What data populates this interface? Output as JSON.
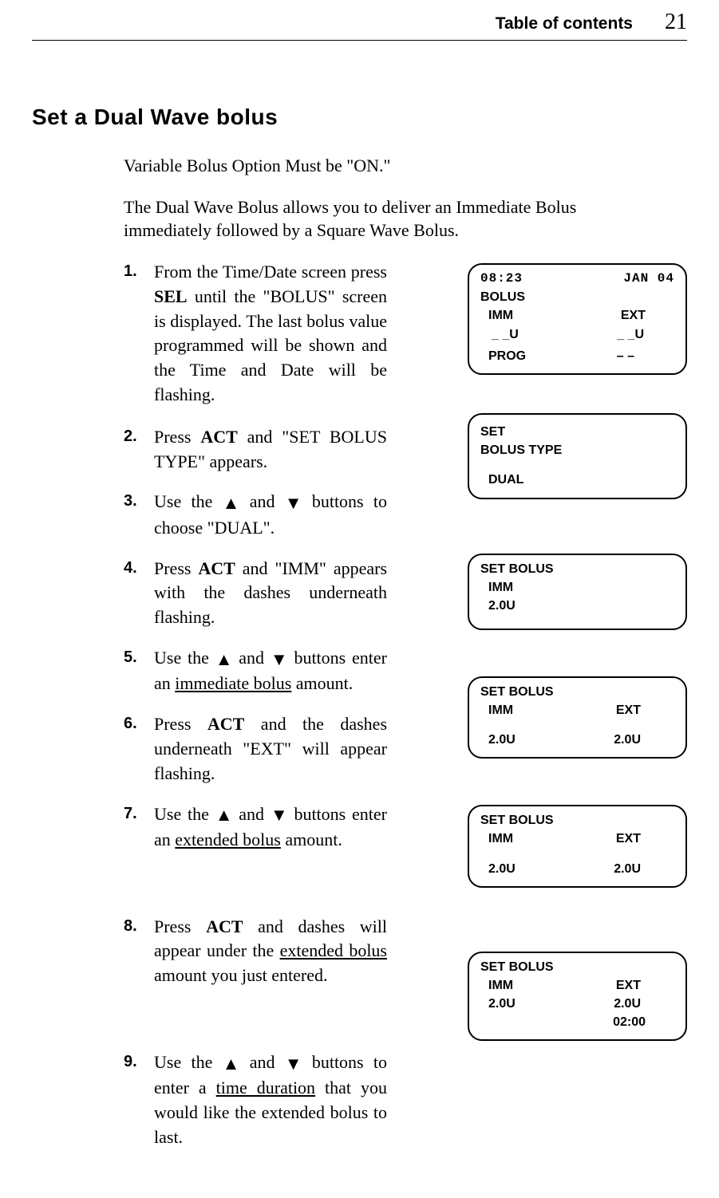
{
  "header": {
    "toc": "Table of contents",
    "page_number": "21"
  },
  "section_title": "Set a Dual Wave bolus",
  "intro1": "Variable Bolus Option Must be \"ON.\"",
  "intro2": "The Dual Wave Bolus allows you to deliver an Immediate Bolus immediately followed by a Square Wave Bolus.",
  "steps": [
    {
      "n": "1.",
      "before": "From the Time/Date screen press ",
      "bold": "SEL",
      "after": " until the \"BOLUS\" screen is displayed. The last bolus value programmed will be shown and the Time and Date will be flashing."
    },
    {
      "n": "2.",
      "before": "Press ",
      "bold": "ACT",
      "after": " and \"SET BOLUS TYPE\" appears."
    },
    {
      "n": "3.",
      "text_a": "Use the ",
      "text_b": " and ",
      "text_c": " buttons to choose \"DUAL\"."
    },
    {
      "n": "4.",
      "before": "Press ",
      "bold": "ACT",
      "after": " and \"IMM\" appears with the dashes underneath flashing."
    },
    {
      "n": "5.",
      "text_a": "Use the ",
      "text_b": " and ",
      "text_c": " buttons enter an ",
      "ul": "immediate bolus",
      "after2": " amount."
    },
    {
      "n": "6.",
      "before": "Press ",
      "bold": "ACT",
      "after": " and the dashes underneath \"EXT\" will appear flashing."
    },
    {
      "n": "7.",
      "text_a": "Use the ",
      "text_b": " and ",
      "text_c": " buttons enter an ",
      "ul": "extended bolus",
      "after2": " amount."
    },
    {
      "n": "8.",
      "before": "Press ",
      "bold": "ACT",
      "after": " and dashes will appear under the ",
      "ul": "extended bolus",
      "after2": " amount you just entered."
    },
    {
      "n": "9.",
      "text_a": "Use the ",
      "text_b": " and ",
      "text_c": " buttons to enter a ",
      "ul": "time duration",
      "after2": " that you would like the extended bolus to last."
    }
  ],
  "screens": {
    "s1": {
      "time": "08:23",
      "date": "JAN 04",
      "bolus": "BOLUS",
      "imm_lbl": "IMM",
      "ext_lbl": "EXT",
      "imm_val": "_ _U",
      "ext_val": "_ _U",
      "prog": "PROG",
      "prog_val": "– –"
    },
    "s2": {
      "l1": "SET",
      "l2": "BOLUS TYPE",
      "l3": "DUAL"
    },
    "s3": {
      "l1": "SET BOLUS",
      "imm_lbl": "IMM",
      "imm_val": "2.0U"
    },
    "s4": {
      "l1": "SET BOLUS",
      "imm_lbl": "IMM",
      "ext_lbl": "EXT",
      "imm_val": "2.0U",
      "ext_val": "2.0U"
    },
    "s5": {
      "l1": "SET BOLUS",
      "imm_lbl": "IMM",
      "ext_lbl": "EXT",
      "imm_val": "2.0U",
      "ext_val": "2.0U"
    },
    "s6": {
      "l1": "SET BOLUS",
      "imm_lbl": "IMM",
      "ext_lbl": "EXT",
      "imm_val": "2.0U",
      "ext_val": "2.0U",
      "dur": "02:00"
    }
  }
}
